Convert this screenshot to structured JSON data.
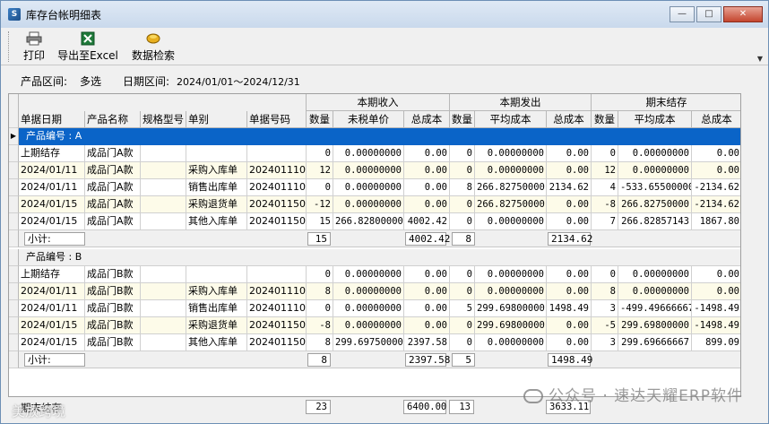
{
  "window": {
    "title": "库存台帐明细表",
    "controls": [
      "minimize",
      "maximize",
      "close"
    ]
  },
  "toolbar": {
    "print_label": "打印",
    "export_label": "导出至Excel",
    "search_label": "数据检索"
  },
  "filter": {
    "product_range_label": "产品区间:",
    "product_range_value": "多选",
    "date_range_label": "日期区间:",
    "date_range_value": "2024/01/01～2024/12/31"
  },
  "grid": {
    "group_headers": {
      "income": "本期收入",
      "outgo": "本期发出",
      "ending": "期末结存"
    },
    "columns": [
      "单据日期",
      "产品名称",
      "规格型号",
      "单别",
      "单据号码",
      "数量",
      "未税单价",
      "总成本",
      "数量",
      "平均成本",
      "总成本",
      "数量",
      "平均成本",
      "总成本"
    ],
    "groups": [
      {
        "label": "产品编号 : A",
        "selected": true,
        "rows": [
          [
            "上期结存",
            "成品门A款",
            "",
            "",
            "",
            "0",
            "0.00000000",
            "0.00",
            "0",
            "0.00000000",
            "0.00",
            "0",
            "0.00000000",
            "0.00"
          ],
          [
            "2024/01/11",
            "成品门A款",
            "",
            "采购入库单",
            "2024011101",
            "12",
            "0.00000000",
            "0.00",
            "0",
            "0.00000000",
            "0.00",
            "12",
            "0.00000000",
            "0.00"
          ],
          [
            "2024/01/11",
            "成品门A款",
            "",
            "销售出库单",
            "2024011101",
            "0",
            "0.00000000",
            "0.00",
            "8",
            "266.82750000",
            "2134.62",
            "4",
            "-533.65500000",
            "-2134.62"
          ],
          [
            "2024/01/15",
            "成品门A款",
            "",
            "采购退货单",
            "2024011501",
            "-12",
            "0.00000000",
            "0.00",
            "0",
            "266.82750000",
            "0.00",
            "-8",
            "266.82750000",
            "-2134.62"
          ],
          [
            "2024/01/15",
            "成品门A款",
            "",
            "其他入库单",
            "2024011502",
            "15",
            "266.82800000",
            "4002.42",
            "0",
            "0.00000000",
            "0.00",
            "7",
            "266.82857143",
            "1867.80"
          ]
        ],
        "subtotal": {
          "label": "小计:",
          "in_qty": "15",
          "in_cost": "4002.42",
          "out_qty": "8",
          "out_cost": "2134.62"
        }
      },
      {
        "label": "产品编号 : B",
        "selected": false,
        "rows": [
          [
            "上期结存",
            "成品门B款",
            "",
            "",
            "",
            "0",
            "0.00000000",
            "0.00",
            "0",
            "0.00000000",
            "0.00",
            "0",
            "0.00000000",
            "0.00"
          ],
          [
            "2024/01/11",
            "成品门B款",
            "",
            "采购入库单",
            "2024011101",
            "8",
            "0.00000000",
            "0.00",
            "0",
            "0.00000000",
            "0.00",
            "8",
            "0.00000000",
            "0.00"
          ],
          [
            "2024/01/11",
            "成品门B款",
            "",
            "销售出库单",
            "2024011101",
            "0",
            "0.00000000",
            "0.00",
            "5",
            "299.69800000",
            "1498.49",
            "3",
            "-499.49666667",
            "-1498.49"
          ],
          [
            "2024/01/15",
            "成品门B款",
            "",
            "采购退货单",
            "2024011501",
            "-8",
            "0.00000000",
            "0.00",
            "0",
            "299.69800000",
            "0.00",
            "-5",
            "299.69800000",
            "-1498.49"
          ],
          [
            "2024/01/15",
            "成品门B款",
            "",
            "其他入库单",
            "2024011502",
            "8",
            "299.69750000",
            "2397.58",
            "0",
            "0.00000000",
            "0.00",
            "3",
            "299.69666667",
            "899.09"
          ]
        ],
        "subtotal": {
          "label": "小计:",
          "in_qty": "8",
          "in_cost": "2397.58",
          "out_qty": "5",
          "out_cost": "1498.49"
        }
      }
    ],
    "footer": {
      "label": "期末结存",
      "in_qty": "23",
      "in_cost": "6400.00",
      "out_qty": "13",
      "out_cost": "3633.11"
    }
  },
  "watermark": {
    "text": "公众号 · 速达天耀ERP软件",
    "corner_text": "美放跨境"
  },
  "colors": {
    "selection": "#0a64c8",
    "header_bg": "#f0f0f0"
  }
}
